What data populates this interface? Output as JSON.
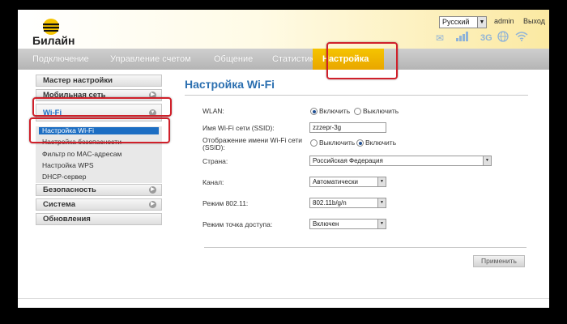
{
  "header": {
    "brand": "Билайн",
    "language": "Русский",
    "admin_link": "admin",
    "exit_link": "Выход",
    "network_type": "3G",
    "brand_color": "#f5c400"
  },
  "nav": {
    "tabs": [
      "Подключение",
      "Управление счетом",
      "Общение",
      "Статистика",
      "Настройка"
    ],
    "active_index": 4
  },
  "sidebar": {
    "items": [
      {
        "label": "Мастер настройки"
      },
      {
        "label": "Мобильная сеть"
      },
      {
        "label": "Wi-Fi"
      },
      {
        "label": "Безопасность"
      },
      {
        "label": "Система"
      },
      {
        "label": "Обновления"
      }
    ],
    "wifi_sub": [
      {
        "label": "Настройка Wi-Fi"
      },
      {
        "label": "Настройка безопасности"
      },
      {
        "label": "Фильтр по MAC-адресам"
      },
      {
        "label": "Настройка WPS"
      },
      {
        "label": "DHCP-сервер"
      }
    ]
  },
  "main": {
    "title": "Настройка Wi-Fi",
    "wlan_label": "WLAN:",
    "wlan_on": "Включить",
    "wlan_off": "Выключить",
    "ssid_label": "Имя Wi-Fi сети (SSID):",
    "ssid_value": "zzzepr-3g",
    "broadcast_label_1": "Отображение имени Wi-Fi сети",
    "broadcast_label_2": "(SSID):",
    "broadcast_off": "Выключить",
    "broadcast_on": "Включить",
    "country_label": "Страна:",
    "country_value": "Российская Федерация",
    "channel_label": "Канал:",
    "channel_value": "Автоматически",
    "mode_label": "Режим 802.11:",
    "mode_value": "802.11b/g/n",
    "ap_label": "Режим точка доступа:",
    "ap_value": "Включен",
    "apply": "Применить"
  },
  "highlight_color": "#d0202a",
  "accent_color": "#2b6fb0"
}
